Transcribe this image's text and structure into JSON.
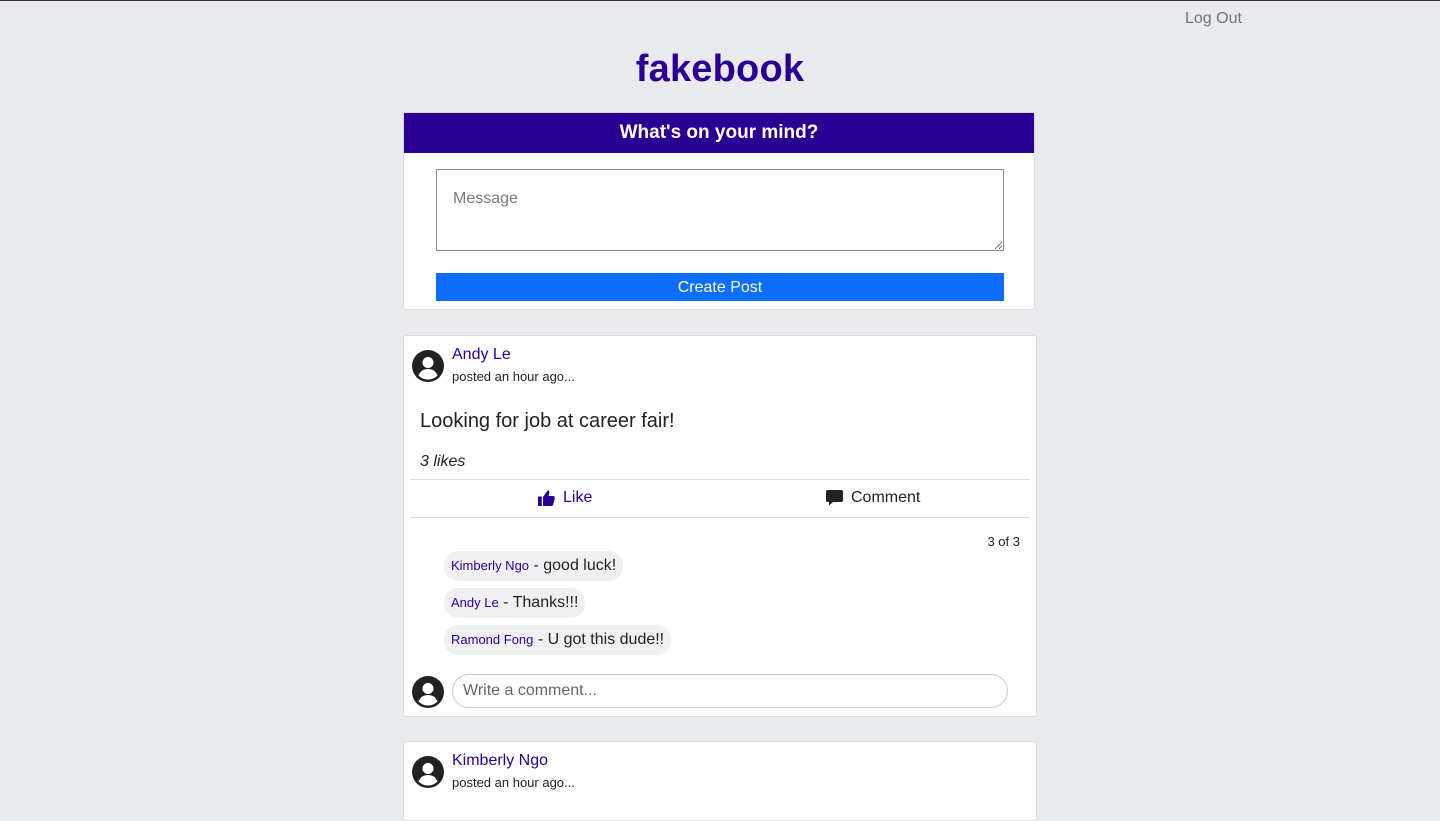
{
  "header": {
    "logout_label": "Log Out",
    "brand": "fakebook"
  },
  "composer": {
    "title": "What's on your mind?",
    "placeholder": "Message",
    "button_label": "Create Post"
  },
  "posts": [
    {
      "author": "Andy Le",
      "time": "posted an hour ago...",
      "body": "Looking for job at career fair!",
      "likes": "3 likes",
      "like_label": "Like",
      "comment_label": "Comment",
      "comment_count": "3 of 3",
      "comments": [
        {
          "author": "Kimberly Ngo",
          "text": " - good luck!"
        },
        {
          "author": "Andy Le",
          "text": " - Thanks!!!"
        },
        {
          "author": "Ramond Fong",
          "text": " - U got this dude!!"
        }
      ],
      "comment_placeholder": "Write a comment..."
    },
    {
      "author": "Kimberly Ngo",
      "time": "posted an hour ago..."
    }
  ],
  "colors": {
    "brand": "#2a0094",
    "primary_button": "#0d6efd",
    "background": "#e9eaee"
  },
  "icons": [
    "user-circle-icon",
    "thumbs-up-icon",
    "comment-icon"
  ]
}
